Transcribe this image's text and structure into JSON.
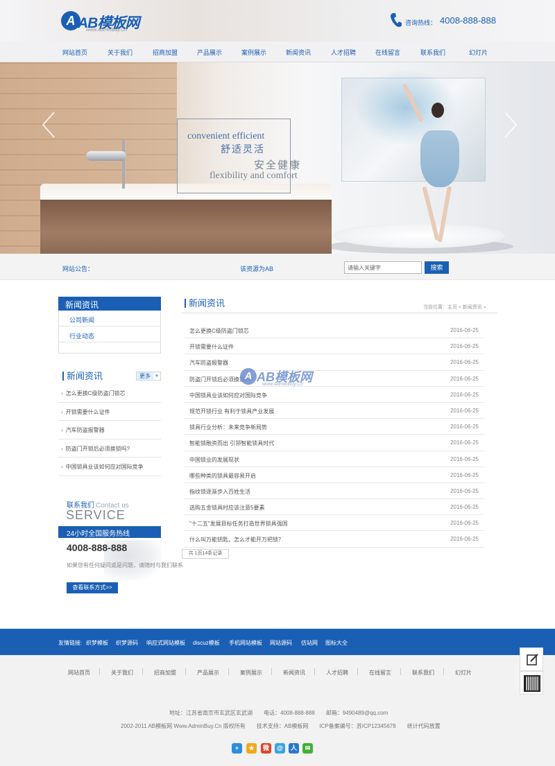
{
  "header": {
    "logo_mark": "A",
    "logo_text": "AB模板网",
    "logo_sub": "www.AdminBuy.Cn",
    "hotline_label": "咨询热线：",
    "hotline_number": "4008-888-888"
  },
  "nav": [
    "网站首页",
    "关于我们",
    "招商加盟",
    "产品展示",
    "案例展示",
    "新闻资讯",
    "人才招聘",
    "在线留言",
    "联系我们",
    "幻灯片"
  ],
  "banner": {
    "slogan_en1": "convenient efficient",
    "slogan_cn1": "舒适灵活",
    "slogan_cn2": "安全健康",
    "slogan_en2": "flexibility and comfort"
  },
  "notice": {
    "label": "网站公告：",
    "text": "该资源为AB",
    "search_placeholder": "请输入关键字",
    "search_button": "搜索"
  },
  "sidebar": {
    "category_title": "新闻资讯",
    "categories": [
      "公司新闻",
      "行业动态"
    ],
    "news_title": "新闻资讯",
    "more_label": "更多",
    "more_plus": "+",
    "news": [
      "怎么更换C级防盗门锁芯",
      "开锁需要什么证件",
      "汽车防盗报警器",
      "防盗门开锁后必须换锁吗?",
      "中国锁具业该如何应对国际竞争"
    ],
    "contact_cn": "联系我们",
    "contact_en": "Contact us",
    "contact_service": "SERVICE",
    "hotline_bar": "24小时全国服务热线",
    "phone": "4008-888-888",
    "desc": "如果您有任何疑问或是问题，请随时与我们联系",
    "contact_button": "查看联系方式>>"
  },
  "main": {
    "title": "新闻资讯",
    "breadcrumb": "当前位置：主页 » 新闻资讯 »",
    "news": [
      {
        "title": "怎么更换C级防盗门锁芯",
        "date": "2016-06-25"
      },
      {
        "title": "开锁需要什么证件",
        "date": "2016-06-25"
      },
      {
        "title": "汽车防盗报警器",
        "date": "2016-06-25"
      },
      {
        "title": "防盗门开锁后必须换锁吗?",
        "date": "2016-06-25"
      },
      {
        "title": "中国锁具业该如何应对国际竞争",
        "date": "2016-06-25"
      },
      {
        "title": "规范开锁行业 有利于锁具产业发展",
        "date": "2016-06-25"
      },
      {
        "title": "锁具行业分析：未来竞争新局势",
        "date": "2016-06-25"
      },
      {
        "title": "智能锁融资而出 引领智能锁具时代",
        "date": "2016-06-25"
      },
      {
        "title": "中国锁业的发展现状",
        "date": "2016-06-25"
      },
      {
        "title": "哪些种类的锁具最容易开启",
        "date": "2016-06-25"
      },
      {
        "title": "指纹锁逐渐步入百姓生活",
        "date": "2016-06-25"
      },
      {
        "title": "选购五金锁具时应该注意5要素",
        "date": "2016-06-25"
      },
      {
        "title": "\"十二五\"发展目标任务打造世界锁具强国",
        "date": "2016-06-25"
      },
      {
        "title": "什么叫万能钥匙，怎么才能开万把锁？",
        "date": "2016-06-25"
      }
    ],
    "pager": "共 1页14条记录"
  },
  "watermark": {
    "mark": "A",
    "text": "AB模板网",
    "sub": "www.AdminBuy.Cn"
  },
  "links": {
    "label": "友情链接:",
    "items": [
      "织梦模板",
      "织梦源码",
      "响应式网站模板",
      "discuz模板",
      "手机网站模板",
      "网站源码",
      "仿站网",
      "图标大全"
    ]
  },
  "footer": {
    "nav": [
      "网站首页",
      "关于我们",
      "招商加盟",
      "产品展示",
      "案例展示",
      "新闻资讯",
      "人才招聘",
      "在线留言",
      "联系我们",
      "幻灯片"
    ],
    "address": "地址：江苏省南京市玄武区玄武湖　　电话：4008-888-888　　邮箱：9490489@qq.com",
    "copyright": "2002-2011 AB模板网 Www.AdminBuy.Cn 版权所有　　技术支持：AB模板网　　ICP备案编号：苏ICP12345678　　统计代码放置"
  },
  "colors": {
    "brand_blue": "#1a5fb4",
    "footer_bg": "#f2f2f2"
  }
}
